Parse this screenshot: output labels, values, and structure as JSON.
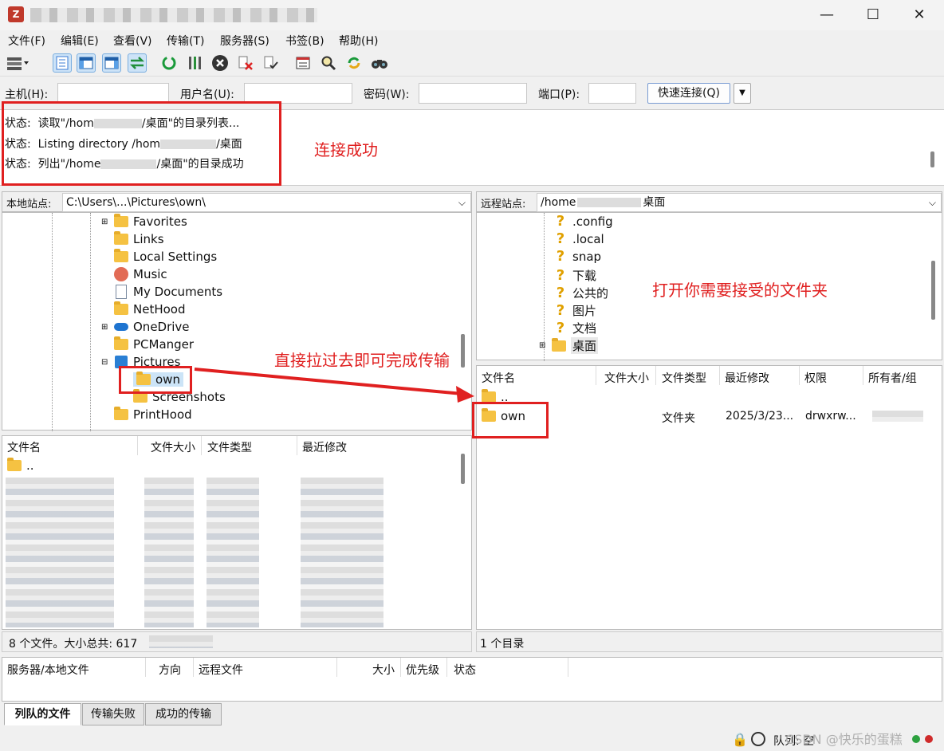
{
  "window": {
    "min": "—",
    "max": "☐",
    "close": "✕"
  },
  "menu": [
    "文件(F)",
    "编辑(E)",
    "查看(V)",
    "传输(T)",
    "服务器(S)",
    "书签(B)",
    "帮助(H)"
  ],
  "quickconnect": {
    "host_label": "主机(H):",
    "user_label": "用户名(U):",
    "pass_label": "密码(W):",
    "port_label": "端口(P):",
    "connect_button": "快速连接(Q)",
    "dropdown": "▼"
  },
  "log": [
    {
      "prefix": "状态:",
      "text": "读取\"/hom",
      "suffix": "/桌面\"的目录列表..."
    },
    {
      "prefix": "状态:",
      "text": "Listing directory /hom",
      "suffix": "/桌面"
    },
    {
      "prefix": "状态:",
      "text": "列出\"/home",
      "suffix": "/桌面\"的目录成功"
    }
  ],
  "annotations": {
    "connected": "连接成功",
    "open_folder": "打开你需要接受的文件夹",
    "drag": "直接拉过去即可完成传输"
  },
  "local": {
    "label": "本地站点:",
    "path": "C:\\Users\\...\\Pictures\\own\\",
    "tree": [
      "Favorites",
      "Links",
      "Local Settings",
      "Music",
      "My Documents",
      "NetHood",
      "OneDrive",
      "PCManger",
      "Pictures",
      "own",
      "Screenshots",
      "PrintHood"
    ],
    "headers": [
      "文件名",
      "文件大小",
      "文件类型",
      "最近修改"
    ],
    "first_row": "..",
    "status": "8 个文件。大小总共: 617"
  },
  "remote": {
    "label": "远程站点:",
    "path": "/home",
    "path_suffix": "桌面",
    "tree": [
      ".config",
      ".local",
      "snap",
      "下载",
      "公共的",
      "图片",
      "文档",
      "桌面"
    ],
    "headers": [
      "文件名",
      "文件大小",
      "文件类型",
      "最近修改",
      "权限",
      "所有者/组"
    ],
    "rows": [
      {
        "name": "..",
        "type": "",
        "modified": "",
        "perm": ""
      },
      {
        "name": "own",
        "type": "文件夹",
        "modified": "2025/3/23...",
        "perm": "drwxrw..."
      }
    ],
    "status": "1 个目录"
  },
  "queue": {
    "headers": [
      "服务器/本地文件",
      "方向",
      "远程文件",
      "大小",
      "优先级",
      "状态"
    ],
    "tabs": [
      "列队的文件",
      "传输失败",
      "成功的传输"
    ],
    "status": "队列: 空"
  },
  "watermark": "CSDN @快乐的蛋糕",
  "colors": {
    "annotation": "#e02020",
    "folder": "#f5c242"
  }
}
